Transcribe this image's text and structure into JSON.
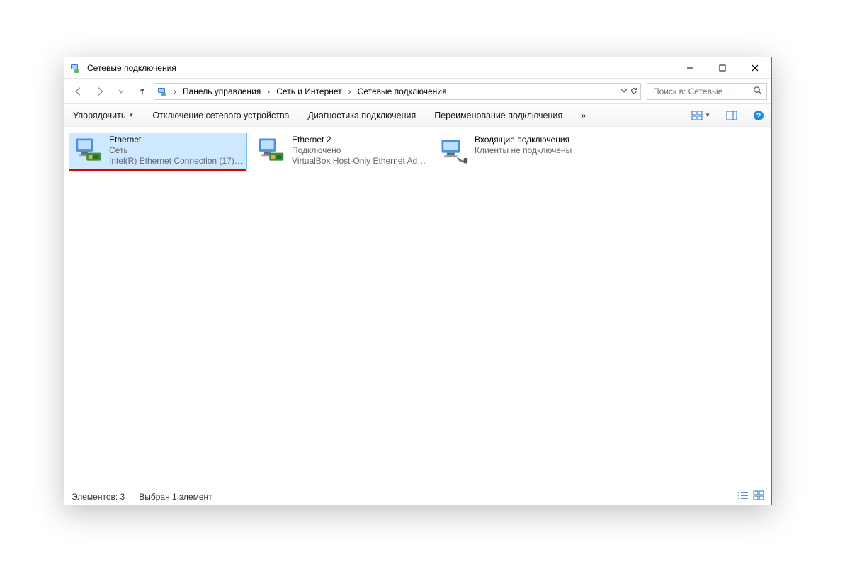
{
  "window": {
    "title": "Сетевые подключения"
  },
  "breadcrumb": {
    "items": [
      "Панель управления",
      "Сеть и Интернет",
      "Сетевые подключения"
    ]
  },
  "search": {
    "placeholder": "Поиск в: Сетевые …"
  },
  "commands": {
    "organize": "Упорядочить",
    "disable": "Отключение сетевого устройства",
    "diagnose": "Диагностика подключения",
    "rename": "Переименование подключения",
    "overflow": "»"
  },
  "connections": [
    {
      "name": "Ethernet",
      "status": "Сеть",
      "device": "Intel(R) Ethernet Connection (17) …",
      "selected": true,
      "highlighted": true,
      "iconType": "nic"
    },
    {
      "name": "Ethernet 2",
      "status": "Подключено",
      "device": "VirtualBox Host-Only Ethernet Ad…",
      "selected": false,
      "highlighted": false,
      "iconType": "nic"
    },
    {
      "name": "Входящие подключения",
      "status": "Клиенты не подключены",
      "device": "",
      "selected": false,
      "highlighted": false,
      "iconType": "incoming"
    }
  ],
  "statusbar": {
    "count": "Элементов: 3",
    "selection": "Выбран 1 элемент"
  }
}
